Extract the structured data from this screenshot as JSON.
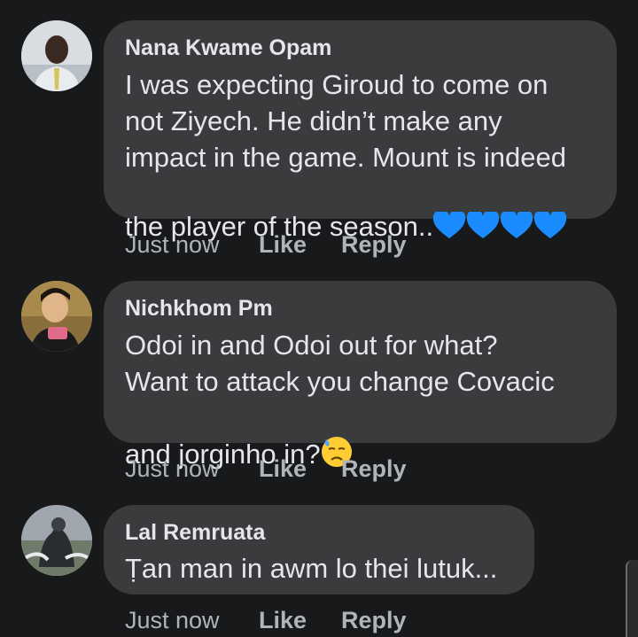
{
  "comments": [
    {
      "author": "Nana Kwame Opam",
      "text": "I was expecting Giroud to come on\nnot Ziyech. He didn’t make any\nimpact in the game. Mount is indeed\nthe player of the season..",
      "emoji": "blue-heart x4",
      "time": "Just now",
      "like": "Like",
      "reply": "Reply"
    },
    {
      "author": "Nichkhom Pm",
      "text": "Odoi in and Odoi out for what?\nWant to attack you change Covacic\nand jorginho in?",
      "emoji": "downcast-face-with-sweat",
      "time": "Just now",
      "like": "Like",
      "reply": "Reply"
    },
    {
      "author": "Lal Remruata",
      "text": "Ṭan man in awm lo thei lutuk...",
      "time": "Just now",
      "like": "Like",
      "reply": "Reply"
    }
  ],
  "colors": {
    "background": "#18191a",
    "bubble": "#3a3b3c",
    "text": "#e4e6eb",
    "secondary": "#b0b3b8",
    "heart": "#1a8cff"
  }
}
